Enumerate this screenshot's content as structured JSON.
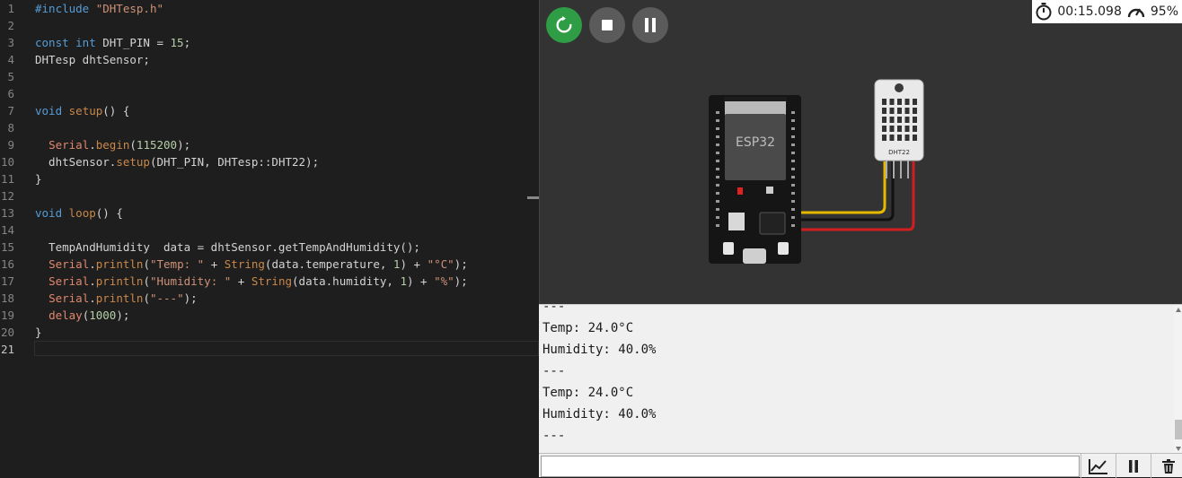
{
  "editor": {
    "lines": [
      {
        "n": "1",
        "tokens": [
          {
            "t": "#include ",
            "c": "inc"
          },
          {
            "t": "\"DHTesp.h\"",
            "c": "str"
          }
        ]
      },
      {
        "n": "2",
        "tokens": []
      },
      {
        "n": "3",
        "tokens": [
          {
            "t": "const ",
            "c": "kw"
          },
          {
            "t": "int ",
            "c": "kw"
          },
          {
            "t": "DHT_PIN = ",
            "c": "pln"
          },
          {
            "t": "15",
            "c": "num"
          },
          {
            "t": ";",
            "c": "pln"
          }
        ]
      },
      {
        "n": "4",
        "tokens": [
          {
            "t": "DHTesp dhtSensor;",
            "c": "pln"
          }
        ]
      },
      {
        "n": "5",
        "tokens": []
      },
      {
        "n": "6",
        "tokens": []
      },
      {
        "n": "7",
        "tokens": [
          {
            "t": "void ",
            "c": "kw"
          },
          {
            "t": "setup",
            "c": "fn"
          },
          {
            "t": "() {",
            "c": "pln"
          }
        ]
      },
      {
        "n": "8",
        "tokens": []
      },
      {
        "n": "9",
        "tokens": [
          {
            "t": "  ",
            "c": "pln"
          },
          {
            "t": "Serial",
            "c": "ser"
          },
          {
            "t": ".",
            "c": "pln"
          },
          {
            "t": "begin",
            "c": "fn"
          },
          {
            "t": "(",
            "c": "pln"
          },
          {
            "t": "115200",
            "c": "num"
          },
          {
            "t": ");",
            "c": "pln"
          }
        ]
      },
      {
        "n": "10",
        "tokens": [
          {
            "t": "  dhtSensor.",
            "c": "pln"
          },
          {
            "t": "setup",
            "c": "fn"
          },
          {
            "t": "(DHT_PIN, DHTesp::DHT22);",
            "c": "pln"
          }
        ]
      },
      {
        "n": "11",
        "tokens": [
          {
            "t": "}",
            "c": "pln"
          }
        ]
      },
      {
        "n": "12",
        "tokens": []
      },
      {
        "n": "13",
        "tokens": [
          {
            "t": "void ",
            "c": "kw"
          },
          {
            "t": "loop",
            "c": "fn"
          },
          {
            "t": "() {",
            "c": "pln"
          }
        ]
      },
      {
        "n": "14",
        "tokens": []
      },
      {
        "n": "15",
        "tokens": [
          {
            "t": "  TempAndHumidity  data = dhtSensor.getTempAndHumidity();",
            "c": "pln"
          }
        ]
      },
      {
        "n": "16",
        "tokens": [
          {
            "t": "  ",
            "c": "pln"
          },
          {
            "t": "Serial",
            "c": "ser"
          },
          {
            "t": ".",
            "c": "pln"
          },
          {
            "t": "println",
            "c": "fn"
          },
          {
            "t": "(",
            "c": "pln"
          },
          {
            "t": "\"Temp: \"",
            "c": "str"
          },
          {
            "t": " + ",
            "c": "pln"
          },
          {
            "t": "String",
            "c": "fn"
          },
          {
            "t": "(data.temperature, ",
            "c": "pln"
          },
          {
            "t": "1",
            "c": "num"
          },
          {
            "t": ") + ",
            "c": "pln"
          },
          {
            "t": "\"°C\"",
            "c": "str"
          },
          {
            "t": ");",
            "c": "pln"
          }
        ]
      },
      {
        "n": "17",
        "tokens": [
          {
            "t": "  ",
            "c": "pln"
          },
          {
            "t": "Serial",
            "c": "ser"
          },
          {
            "t": ".",
            "c": "pln"
          },
          {
            "t": "println",
            "c": "fn"
          },
          {
            "t": "(",
            "c": "pln"
          },
          {
            "t": "\"Humidity: \"",
            "c": "str"
          },
          {
            "t": " + ",
            "c": "pln"
          },
          {
            "t": "String",
            "c": "fn"
          },
          {
            "t": "(data.humidity, ",
            "c": "pln"
          },
          {
            "t": "1",
            "c": "num"
          },
          {
            "t": ") + ",
            "c": "pln"
          },
          {
            "t": "\"%\"",
            "c": "str"
          },
          {
            "t": ");",
            "c": "pln"
          }
        ]
      },
      {
        "n": "18",
        "tokens": [
          {
            "t": "  ",
            "c": "pln"
          },
          {
            "t": "Serial",
            "c": "ser"
          },
          {
            "t": ".",
            "c": "pln"
          },
          {
            "t": "println",
            "c": "fn"
          },
          {
            "t": "(",
            "c": "pln"
          },
          {
            "t": "\"---\"",
            "c": "str"
          },
          {
            "t": ");",
            "c": "pln"
          }
        ]
      },
      {
        "n": "19",
        "tokens": [
          {
            "t": "  ",
            "c": "pln"
          },
          {
            "t": "delay",
            "c": "ser"
          },
          {
            "t": "(",
            "c": "pln"
          },
          {
            "t": "1000",
            "c": "num"
          },
          {
            "t": ");",
            "c": "pln"
          }
        ]
      },
      {
        "n": "20",
        "tokens": [
          {
            "t": "}",
            "c": "pln"
          }
        ]
      },
      {
        "n": "21",
        "tokens": [],
        "active": true
      }
    ]
  },
  "simulator": {
    "controls": {
      "restart": "restart-icon",
      "stop": "stop-icon",
      "pause": "pause-icon"
    },
    "timer": "00:15.098",
    "speed": "95%",
    "board_label": "ESP32",
    "sensor_label": "DHT22",
    "colors": {
      "wire_yellow": "#e6b800",
      "wire_black": "#111111",
      "wire_red": "#d21e1e",
      "board": "#151515",
      "green": "#2e9d46"
    }
  },
  "serial_monitor": {
    "lines": [
      "---",
      "Temp: 24.0°C",
      "Humidity: 40.0%",
      "---",
      "Temp: 24.0°C",
      "Humidity: 40.0%",
      "---"
    ]
  },
  "toolbar": {
    "plot_icon": "chart-icon",
    "pause_icon": "pause-icon",
    "clear_icon": "trash-icon"
  }
}
